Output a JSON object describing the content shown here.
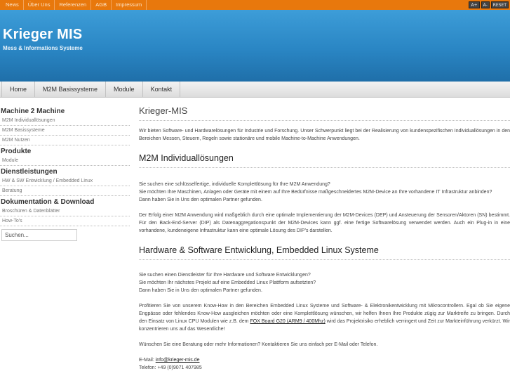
{
  "topnav": [
    "News",
    "Über Uns",
    "Referenzen",
    "AGB",
    "Impressum"
  ],
  "font_tools": {
    "increase": "A+",
    "decrease": "A-",
    "reset": "RESET"
  },
  "banner": {
    "title": "Krieger MIS",
    "subtitle": "Mess & Informations Systeme"
  },
  "mainnav": [
    "Home",
    "M2M Basissysteme",
    "Module",
    "Kontakt"
  ],
  "sidebar": {
    "sections": [
      {
        "heading": "Machine 2 Machine",
        "items": [
          "M2M Individuallösungen",
          "M2M Basissysteme",
          "M2M Nutzen"
        ]
      },
      {
        "heading": "Produkte",
        "items": [
          "Module"
        ]
      },
      {
        "heading": "Dienstleistungen",
        "items": [
          "HW & SW Entwicklung / Embedded Linux",
          "Beratung"
        ]
      },
      {
        "heading": "Dokumentation & Download",
        "items": [
          "Broschüren & Datenblätter",
          "How-To's"
        ]
      }
    ],
    "search_value": "Suchen..."
  },
  "content": {
    "title": "Krieger-MIS",
    "intro": "Wir bieten Software- und Hardwarelösungen für Industrie und Forschung. Unser Schwerpunkt liegt bei der Realisierung von kundenspezifischen Individuallösungen in den Bereichen Messen, Steuern, Regeln sowie stationäre und mobile Machine-to-Machine Anwendungen.",
    "section1": {
      "heading": "M2M Individuallösungen",
      "p1_l1": "Sie suchen eine schlüsselfertige, individuelle Komplettlösung für Ihre M2M Anwendung?",
      "p1_l2": "Sie möchten Ihre Maschinen, Anlagen oder Geräte mit einem auf Ihre Bedürfnisse maßgeschneidertes M2M-Device an Ihre vorhandene IT Infrastruktur anbinden?",
      "p1_l3": "Dann haben Sie in Uns den optimalen Partner gefunden.",
      "p2": "Der Erfolg einer M2M Anwendung wird maßgeblich durch eine optimale Implementierung der M2M-Devices (DEP) und Ansteuerung der Sensoren/Aktoren (SN) bestimmt. Für den Back-End-Server (DIP) als Datenaggregationspunkt  der M2M-Devices kann ggf. eine fertige Softwarelösung verwendet werden. Auch ein Plug-in in eine vorhandene, kundeneigene Infrastruktur kann eine optimale Lösung des DIP's darstellen."
    },
    "section2": {
      "heading": "Hardware & Software Entwicklung, Embedded Linux Systeme",
      "p1_l1": "Sie suchen einen Dienstleister für Ihre Hardware und Software Entwicklungen?",
      "p1_l2": "Sie möchten Ihr nächstes Projekt auf eine Embedded Linux Plattform aufsetzten?",
      "p1_l3": "Dann haben Sie in Uns den optimalen Partner gefunden.",
      "p2_a": "Profitieren Sie von unserem Know-How in den Bereichen Embedded Linux Systeme und Software- & Elektronikentwicklung mit Mikrocontrollern. Egal ob Sie eigene Engpässe oder fehlendes Know-How ausgleichen möchten oder eine Komplettlösung wünschen, wir helfen Ihnen Ihre Produkte zügig zur Marktreife zu bringen. Durch den Einsatz von Linux CPU Modulen wie z.B. dem ",
      "p2_link": "FOX Board G20 (ARM9 / 400Mhz)",
      "p2_b": " wird das Projektrisiko erheblich verringert und Zeit zur Markteinführung verkürzt. Wir konzentrieren uns auf das Wesentliche!",
      "p3": "Wünschen Sie eine Beratung oder mehr Informationen? Kontaktieren Sie uns einfach per E-Mail oder Telefon.",
      "email_label": "E-Mail: ",
      "email": "info@krieger-mis.de",
      "phone": "Telefon: +49 (0)9071 407985"
    }
  }
}
